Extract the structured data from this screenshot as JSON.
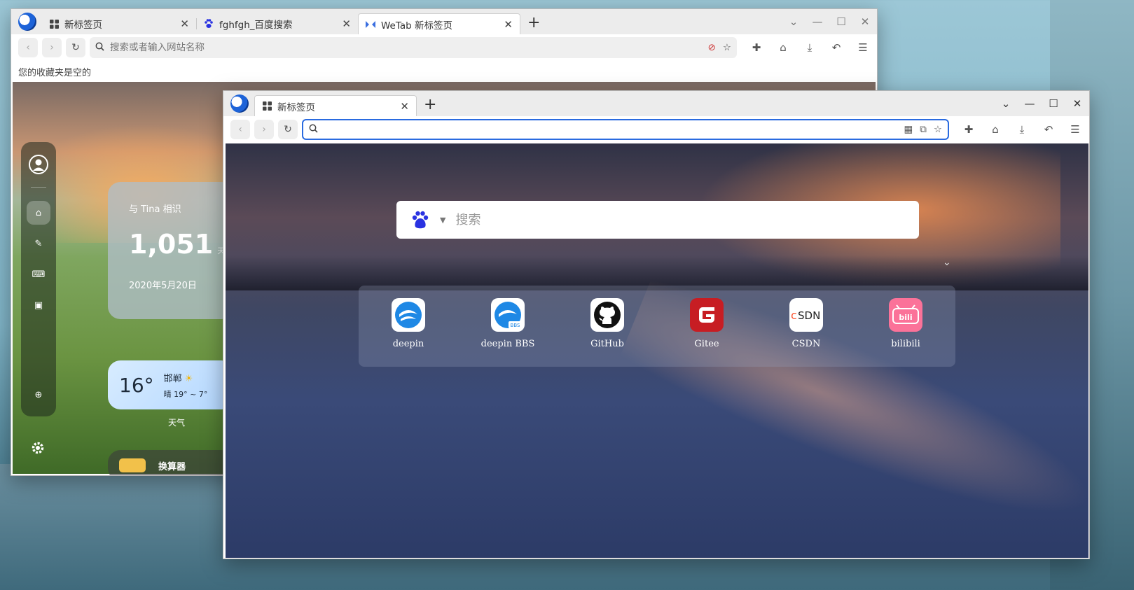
{
  "back_window": {
    "tabs": [
      {
        "label": "新标签页",
        "icon": "grid-icon",
        "close": "✕"
      },
      {
        "label": "fghfgh_百度搜索",
        "icon": "baidu-paw-icon",
        "close": "✕"
      },
      {
        "label": "WeTab 新标签页",
        "icon": "wetab-icon",
        "close": "✕"
      }
    ],
    "newtab_glyph": "+",
    "address_value": "",
    "address_placeholder": "搜索或者输入网站名称",
    "bookmarks_empty": "您的收藏夹是空的",
    "wetab": {
      "countdown_title": "与 Tina 相识",
      "countdown_value": "1,051",
      "countdown_unit": "天",
      "countdown_date": "2020年5月20日",
      "weather_temp": "16°",
      "weather_city": "邯郸",
      "weather_detail": "晴  19° ~ 7°",
      "weather_caption": "天气",
      "calculator_label": "换算器"
    }
  },
  "front_window": {
    "tabs": [
      {
        "label": "新标签页",
        "icon": "grid-icon",
        "close": "✕"
      }
    ],
    "newtab_glyph": "+",
    "address_value": "",
    "search": {
      "engine": "baidu",
      "placeholder": "搜索"
    },
    "shortcuts": [
      {
        "label": "deepin",
        "icon": "deepin-icon",
        "bg": "#ffffff"
      },
      {
        "label": "deepin BBS",
        "icon": "deepin-bbs-icon",
        "bg": "#ffffff"
      },
      {
        "label": "GitHub",
        "icon": "github-icon",
        "bg": "#ffffff"
      },
      {
        "label": "Gitee",
        "icon": "gitee-icon",
        "bg": "#c71d23"
      },
      {
        "label": "CSDN",
        "icon": "csdn-icon",
        "bg": "#ffffff"
      },
      {
        "label": "bilibili",
        "icon": "bilibili-icon",
        "bg": "#fb7299"
      }
    ]
  },
  "colors": {
    "accent": "#2a6be0",
    "gitee_red": "#c71d23",
    "bilibili_pink": "#fb7299",
    "csdn_red": "#fc5531",
    "baidu_blue": "#2932e1"
  }
}
